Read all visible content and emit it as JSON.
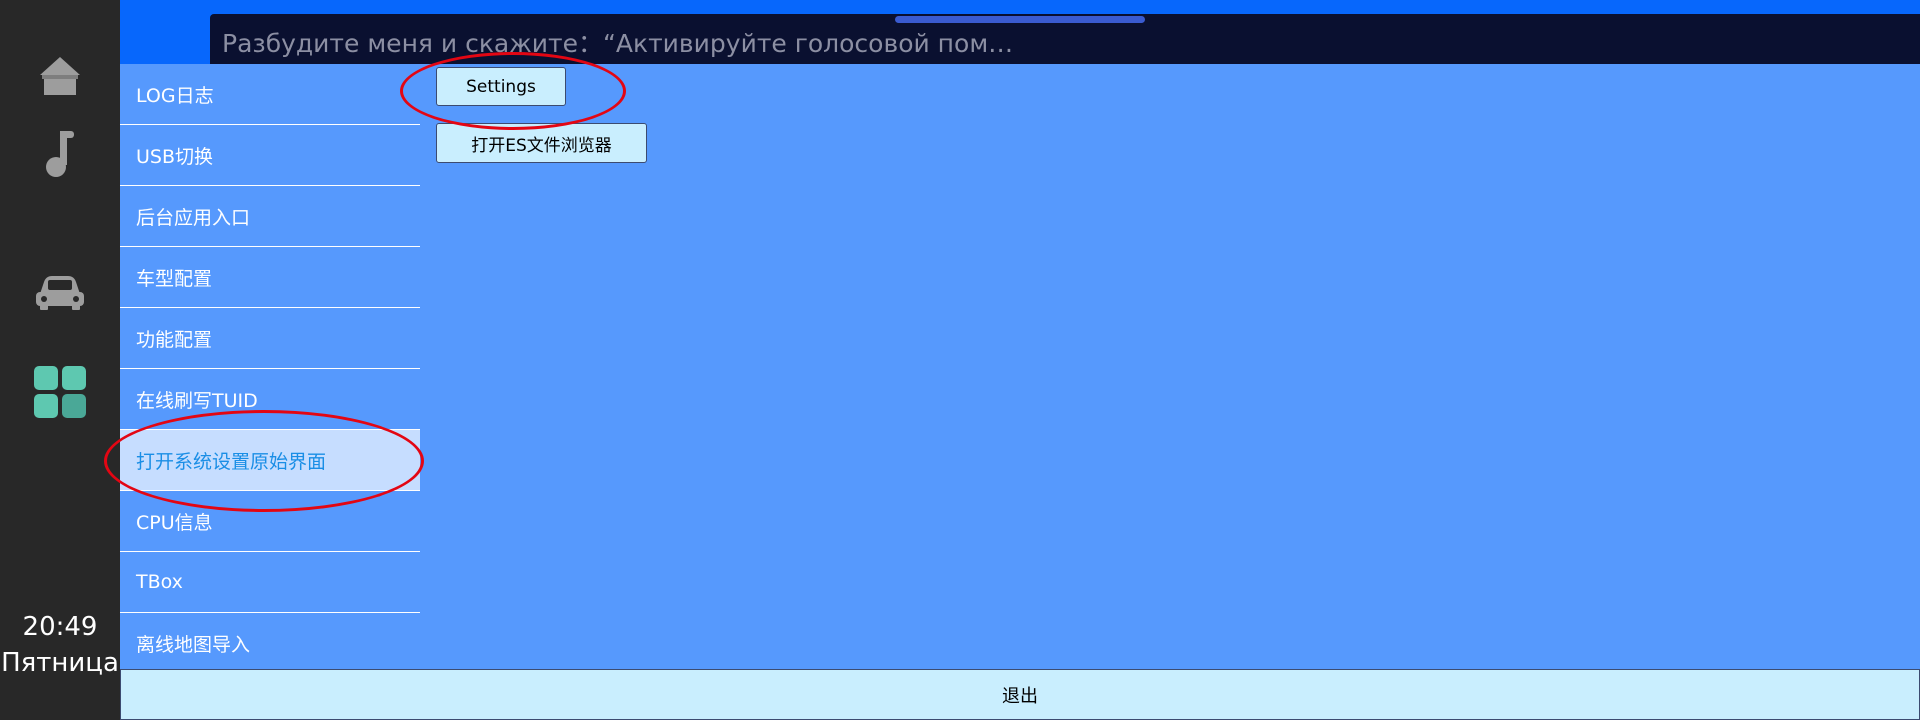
{
  "dock": {
    "icons": [
      "home-icon",
      "music-icon",
      "car-icon",
      "apps-icon"
    ],
    "time": "20:49",
    "day": "Пятница"
  },
  "topbar": {
    "voice_hint": "Разбудите меня и скажите：“Активируйте голосовой пом…"
  },
  "menu": {
    "items": [
      {
        "label": "LOG日志"
      },
      {
        "label": "USB切换"
      },
      {
        "label": "后台应用入口"
      },
      {
        "label": "车型配置"
      },
      {
        "label": "功能配置"
      },
      {
        "label": "在线刷写TUID"
      },
      {
        "label": "打开系统设置原始界面",
        "active": true
      },
      {
        "label": "CPU信息"
      },
      {
        "label": "TBox"
      },
      {
        "label": "离线地图导入"
      }
    ]
  },
  "actions": {
    "settings_label": "Settings",
    "es_browser_label": "打开ES文件浏览器"
  },
  "footer": {
    "exit_label": "退出"
  },
  "colors": {
    "background": "#5699fd",
    "topbar": "#0767fc",
    "dock": "#282828",
    "button": "#c9eefe",
    "annotation": "#e30613",
    "active_item_text": "#1a8ee6"
  }
}
